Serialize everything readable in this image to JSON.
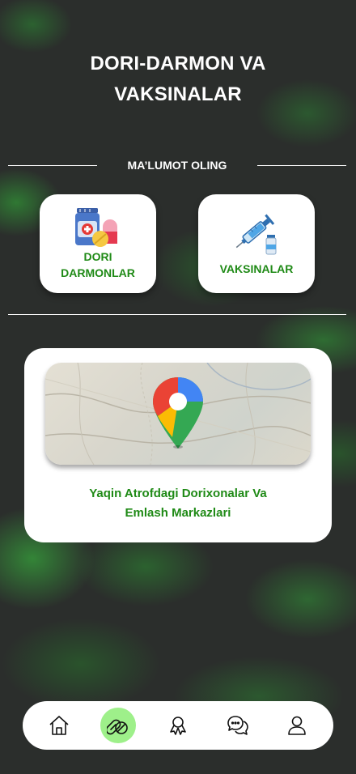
{
  "header": {
    "title_line1": "DORI-DARMON VA",
    "title_line2": "VAKSINALAR"
  },
  "section": {
    "label": "MA’LUMOT OLING"
  },
  "cards": {
    "medicines": {
      "line1": "DORI",
      "line2": "DARMONLAR",
      "icon": "medicine-pills-icon"
    },
    "vaccines": {
      "label": "VAKSINALAR",
      "icon": "syringe-vaccine-icon"
    }
  },
  "map_card": {
    "line1": "Yaqin Atrofdagi Dorixonalar Va",
    "line2": "Emlash Markazlari",
    "icon": "google-maps-pin-icon"
  },
  "navbar": {
    "items": [
      {
        "name": "home",
        "icon": "home-icon",
        "active": false
      },
      {
        "name": "medicines",
        "icon": "pills-icon",
        "active": true
      },
      {
        "name": "awards",
        "icon": "award-icon",
        "active": false
      },
      {
        "name": "chat",
        "icon": "chat-icon",
        "active": false
      },
      {
        "name": "profile",
        "icon": "user-icon",
        "active": false
      }
    ]
  },
  "colors": {
    "accent_green": "#1f8a16",
    "active_nav": "#9ef08a",
    "background": "#2b2e2c"
  }
}
